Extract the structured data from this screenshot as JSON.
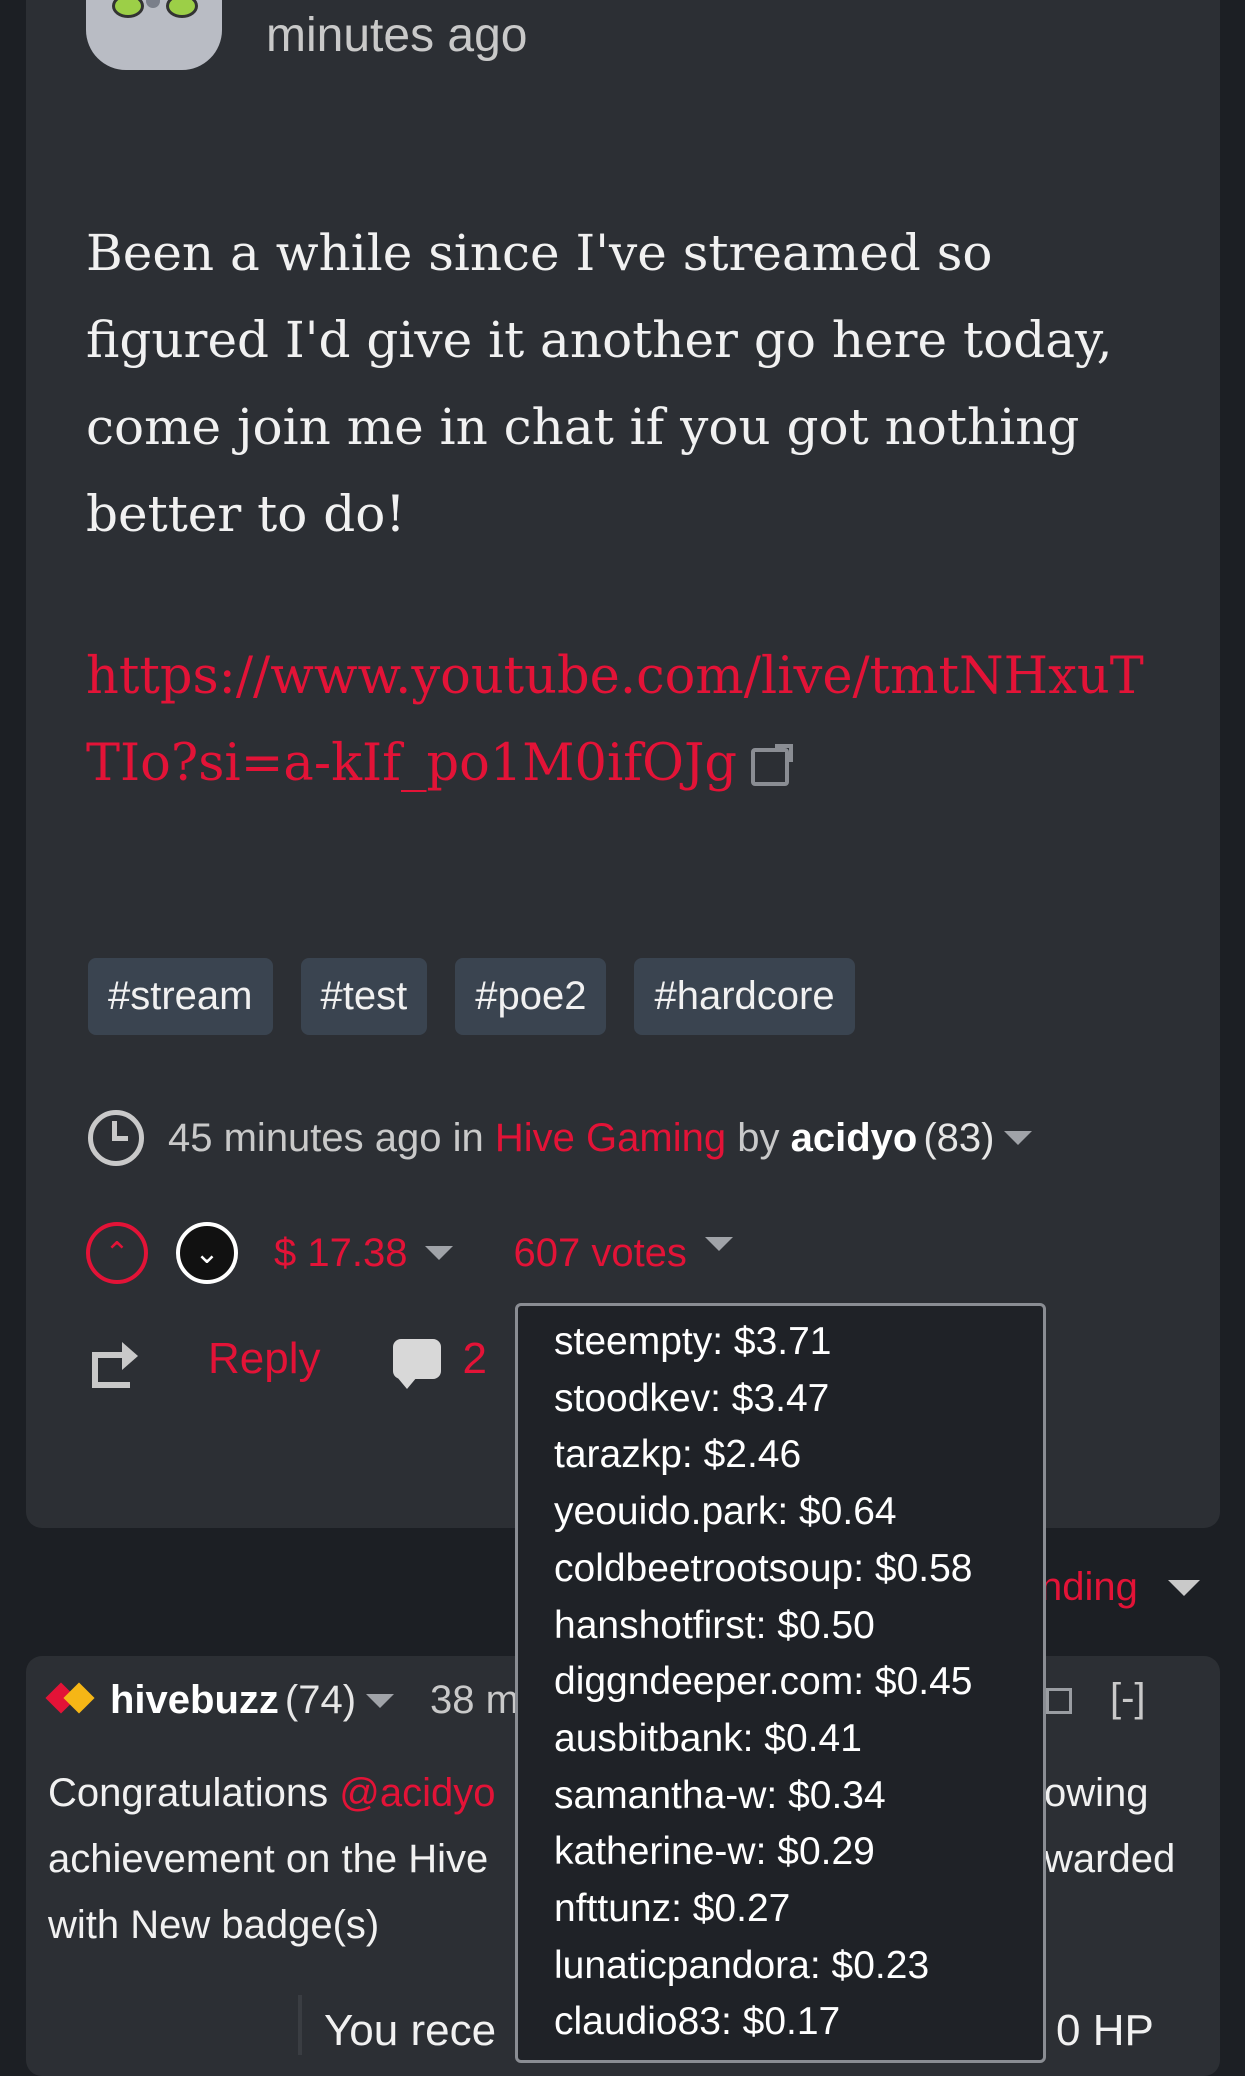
{
  "post": {
    "time_top": "minutes ago",
    "body": "Been a while since I've streamed so figured I'd give it another go here today, come join me in chat if you got nothing better to do!",
    "link": "https://www.youtube.com/live/tmtNHxuTTIo?si=a-kIf_po1M0ifOJg",
    "tags": [
      "#stream",
      "#test",
      "#poe2",
      "#hardcore"
    ],
    "meta": {
      "time": "45 minutes ago in",
      "community": "Hive Gaming",
      "by": "by",
      "author": "acidyo",
      "reputation": "(83)"
    },
    "payout": "$ 17.38",
    "votes": "607 votes",
    "reply_label": "Reply",
    "comment_count": "2"
  },
  "sort": {
    "label_partial": "nding"
  },
  "voters_popup": [
    "steempty: $3.71",
    "stoodkev: $3.47",
    "tarazkp: $2.46",
    "yeouido.park: $0.64",
    "coldbeetrootsoup: $0.58",
    "hanshotfirst: $0.50",
    "diggndeeper.com: $0.45",
    "ausbitbank: $0.41",
    "samantha-w: $0.34",
    "katherine-w: $0.29",
    "nfttunz: $0.27",
    "lunaticpandora: $0.23",
    "claudio83: $0.17"
  ],
  "comment": {
    "user": "hivebuzz",
    "reputation": "(74)",
    "time_partial": "38 m",
    "collapse": "[-]",
    "line1": "Congratulations ",
    "mention": "@acidyo",
    "line2": "achievement on the Hive",
    "line3": "with New badge(s)",
    "right1": "owing",
    "right2": "warded",
    "footer_left": "You rece",
    "footer_right": "0 HP"
  }
}
